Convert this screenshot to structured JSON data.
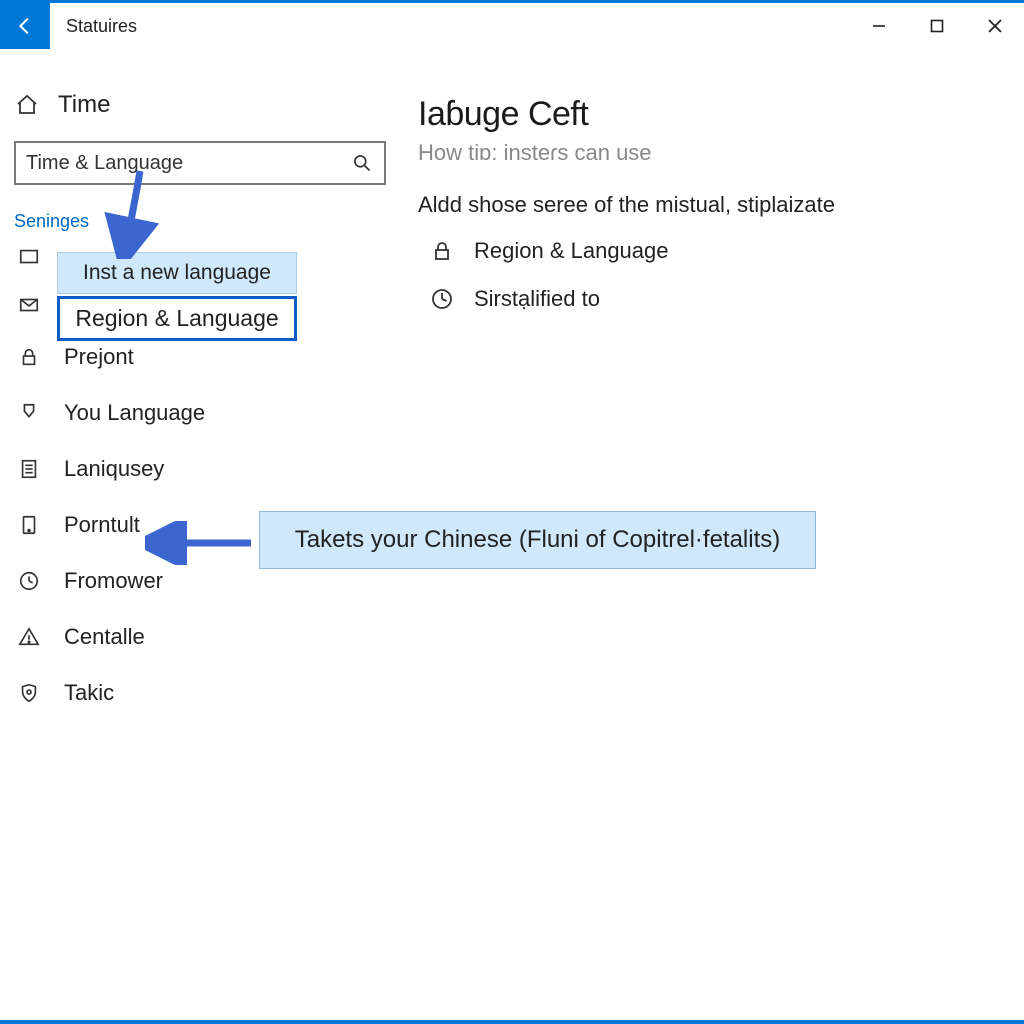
{
  "titlebar": {
    "title": "Statuires"
  },
  "sidebar": {
    "home_label": "Time",
    "search_value": "Time & Language",
    "section_label": "Seninges",
    "nav": [
      {
        "label": "Prejont"
      },
      {
        "label": "You Language"
      },
      {
        "label": "Laniqusey"
      },
      {
        "label": "Porntult"
      },
      {
        "label": "Fromower"
      },
      {
        "label": "Centalle"
      },
      {
        "label": "Takic"
      }
    ]
  },
  "callouts": {
    "new_lang": "Inst a new language",
    "region_lang": "Region & Language",
    "chinese_hint": "Takets your Chinese (Fluni of Copitrel·fetalits)"
  },
  "main": {
    "title": "Iaɓuge Ceft",
    "subtitle": "How tiɒ: insteɾs can use",
    "description": "Aldd shose seree of the mistual, stiplaizate",
    "options": [
      {
        "label": "Region & Language"
      },
      {
        "label": "Sirstạlified to"
      }
    ]
  }
}
